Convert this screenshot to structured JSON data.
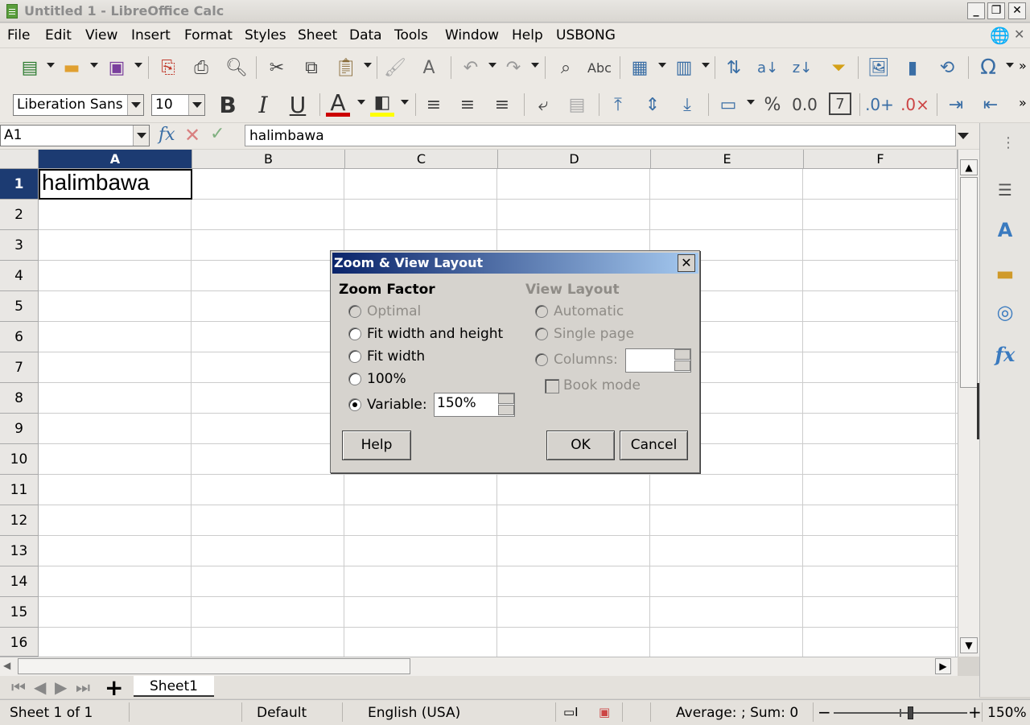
{
  "window": {
    "title": "Untitled 1 - LibreOffice Calc",
    "minimize": "_",
    "restore": "❐",
    "close": "✕"
  },
  "menu": [
    "File",
    "Edit",
    "View",
    "Insert",
    "Format",
    "Styles",
    "Sheet",
    "Data",
    "Tools",
    "Window",
    "Help",
    "USBONG"
  ],
  "formatting": {
    "font_name": "Liberation Sans",
    "font_size": "10"
  },
  "formula_bar": {
    "name_box": "A1",
    "content": "halimbawa"
  },
  "columns": [
    "A",
    "B",
    "C",
    "D",
    "E",
    "F"
  ],
  "rows": [
    "1",
    "2",
    "3",
    "4",
    "5",
    "6",
    "7",
    "8",
    "9",
    "10",
    "11",
    "12",
    "13",
    "14",
    "15",
    "16"
  ],
  "cells": {
    "A1": "halimbawa"
  },
  "dialog": {
    "title": "Zoom & View Layout",
    "close": "✕",
    "zoom_factor": {
      "heading": "Zoom Factor",
      "options": [
        "Optimal",
        "Fit width and height",
        "Fit width",
        "100%",
        "Variable:"
      ],
      "selected": "Variable:",
      "variable_value": "150%"
    },
    "view_layout": {
      "heading": "View Layout",
      "options": [
        "Automatic",
        "Single page",
        "Columns:"
      ],
      "book_mode": "Book mode",
      "columns_value": ""
    },
    "buttons": {
      "help": "Help",
      "ok": "OK",
      "cancel": "Cancel"
    }
  },
  "sheet_tabs": [
    "Sheet1"
  ],
  "status": {
    "sheet": "Sheet 1 of 1",
    "page_style": "Default",
    "language": "English (USA)",
    "summary": "Average: ; Sum: 0",
    "zoom": "150%"
  },
  "icons": [
    "new-icon",
    "open-icon",
    "save-icon",
    "pdf-icon",
    "print-icon",
    "preview-icon",
    "cut-icon",
    "copy-icon",
    "paste-icon",
    "clone-icon",
    "clear-format-icon",
    "undo-icon",
    "redo-icon",
    "find-icon",
    "spelling-icon",
    "row-icon",
    "column-icon",
    "sort-icon",
    "sort-asc-icon",
    "sort-desc-icon",
    "autofilter-icon",
    "image-icon",
    "chart-icon",
    "pivot-icon",
    "special-char-icon"
  ],
  "accent": "#3a6ea5",
  "selection_color": "#1c3b72"
}
